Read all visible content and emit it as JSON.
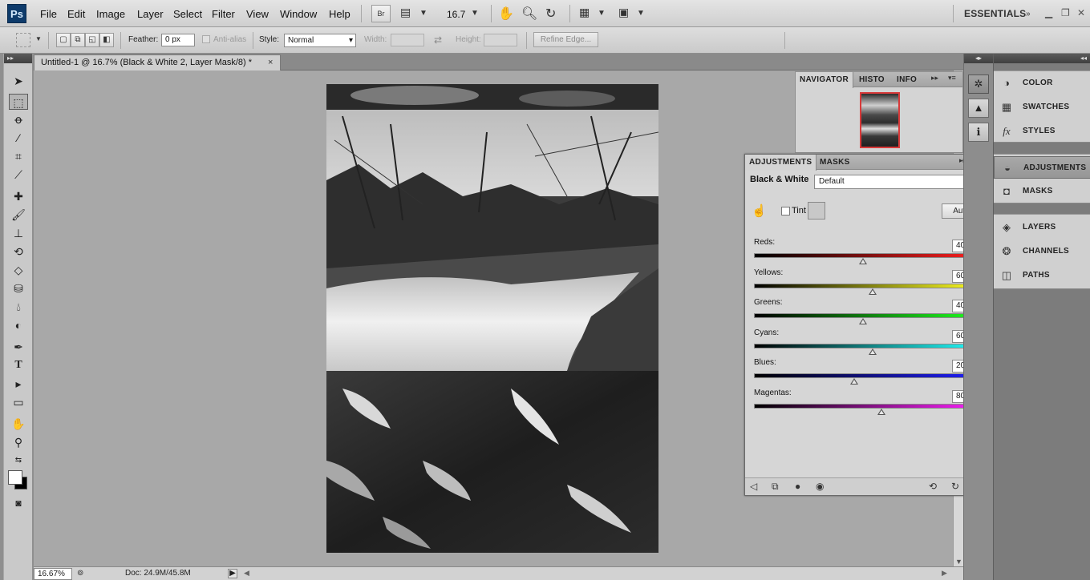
{
  "menubar": {
    "logo": "Ps",
    "items": [
      "File",
      "Edit",
      "Image",
      "Layer",
      "Select",
      "Filter",
      "View",
      "Window",
      "Help"
    ],
    "bridge_label": "Br",
    "zoom_value": "16.7",
    "workspace": "ESSENTIALS"
  },
  "options": {
    "feather_label": "Feather:",
    "feather_value": "0 px",
    "antialias_label": "Anti-alias",
    "style_label": "Style:",
    "style_value": "Normal",
    "width_label": "Width:",
    "height_label": "Height:",
    "refine_label": "Refine Edge..."
  },
  "document": {
    "tab_title": "Untitled-1 @ 16.7% (Black & White 2, Layer Mask/8) *",
    "close_glyph": "×",
    "zoom_status": "16.67%",
    "doc_size": "Doc: 24.9M/45.8M"
  },
  "navigator": {
    "tabs": [
      "NAVIGATOR",
      "HISTO",
      "INFO"
    ]
  },
  "adjustments": {
    "tabs": [
      "ADJUSTMENTS",
      "MASKS"
    ],
    "title": "Black & White",
    "preset": "Default",
    "tint_label": "Tint",
    "auto_label": "Auto",
    "sliders": [
      {
        "label": "Reds:",
        "value": "40",
        "fraction": 0.476
      },
      {
        "label": "Yellows:",
        "value": "60",
        "fraction": 0.516
      },
      {
        "label": "Greens:",
        "value": "40",
        "fraction": 0.476
      },
      {
        "label": "Cyans:",
        "value": "60",
        "fraction": 0.516
      },
      {
        "label": "Blues:",
        "value": "20",
        "fraction": 0.436
      },
      {
        "label": "Magentas:",
        "value": "80",
        "fraction": 0.556
      }
    ],
    "slider_colors": [
      [
        "#000000",
        "#ff2020"
      ],
      [
        "#000000",
        "#ffff20"
      ],
      [
        "#000000",
        "#20ff20"
      ],
      [
        "#000000",
        "#20ffff"
      ],
      [
        "#000000",
        "#2020ff"
      ],
      [
        "#000000",
        "#ff20ff"
      ]
    ]
  },
  "dock": {
    "group1": [
      "COLOR",
      "SWATCHES",
      "STYLES"
    ],
    "group2": [
      "ADJUSTMENTS",
      "MASKS"
    ],
    "group3": [
      "LAYERS",
      "CHANNELS",
      "PATHS"
    ]
  }
}
